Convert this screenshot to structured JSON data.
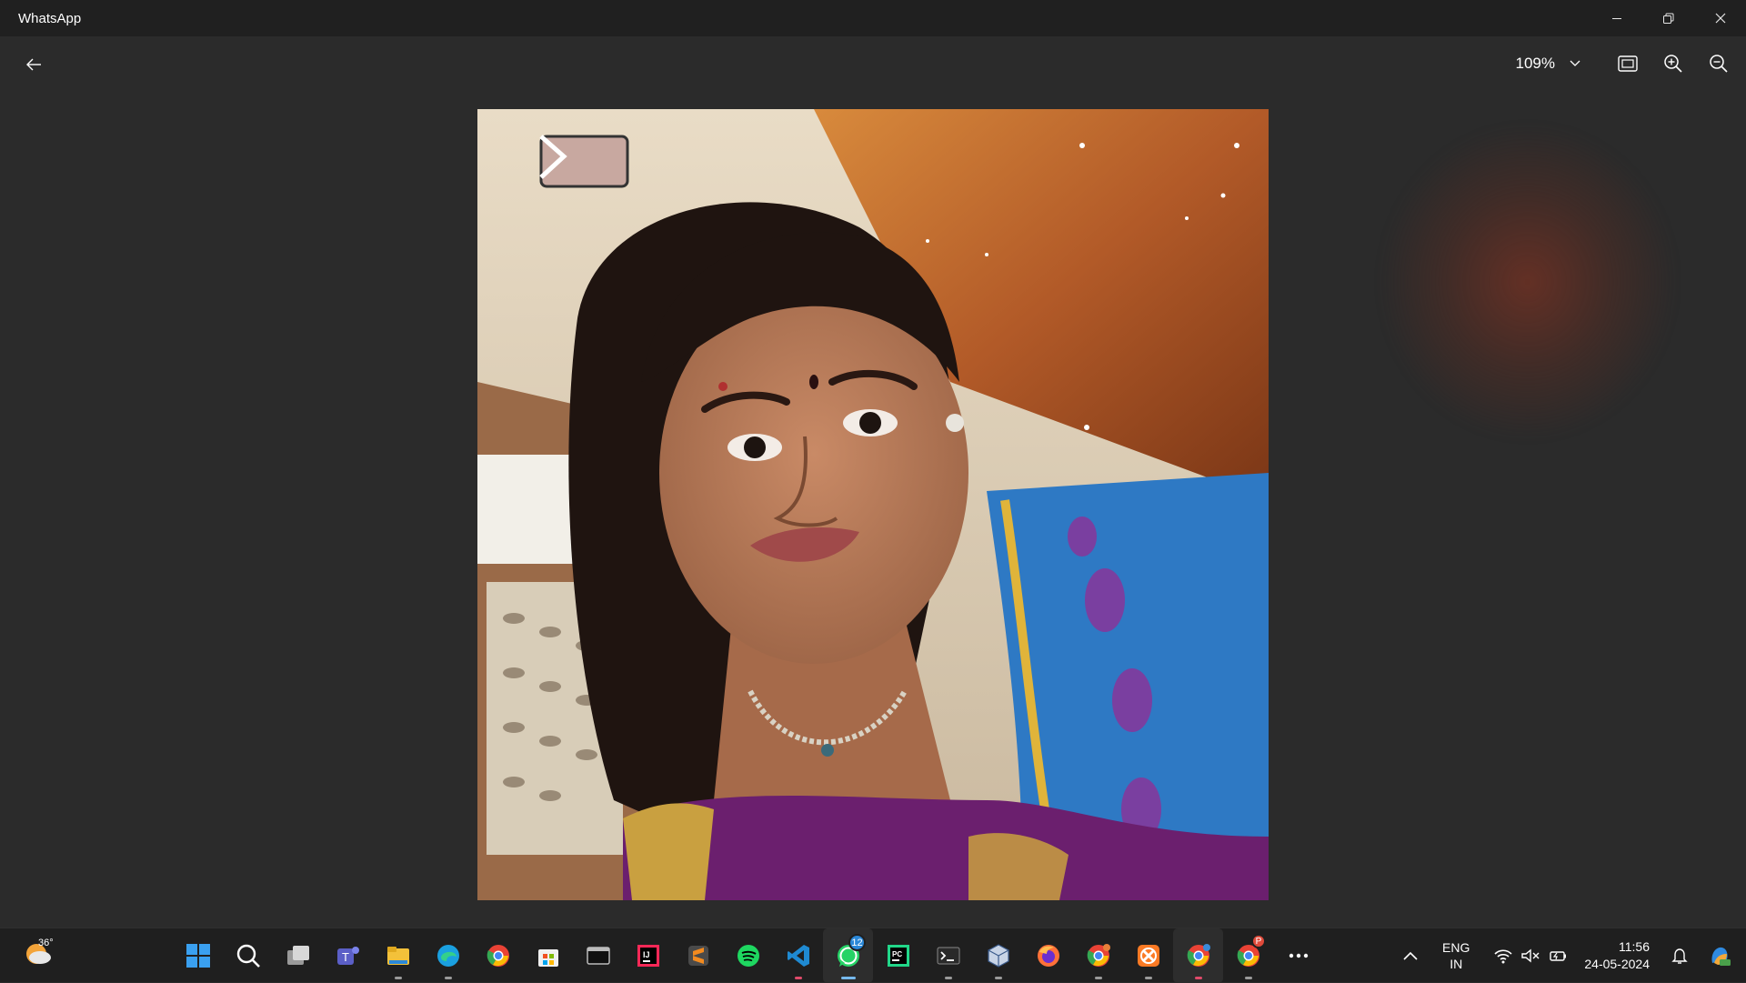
{
  "window": {
    "title": "WhatsApp"
  },
  "viewer": {
    "zoom_level": "109%"
  },
  "weather": {
    "temperature": "36°"
  },
  "taskbar": {
    "apps": [
      {
        "name": "start",
        "color": "#3aa0f0"
      },
      {
        "name": "search",
        "color": "#ffffff"
      },
      {
        "name": "task-view",
        "color": "#cfcfcf"
      },
      {
        "name": "teams",
        "color": "#5b5fc7"
      },
      {
        "name": "file-explorer",
        "color": "#f3c13a"
      },
      {
        "name": "edge",
        "color": "#1aa0e0"
      },
      {
        "name": "chrome",
        "color": "#e94235"
      },
      {
        "name": "microsoft-store",
        "color": "#f0f0f0"
      },
      {
        "name": "terminal-window",
        "color": "#3a3a3a"
      },
      {
        "name": "intellij",
        "color": "#1e2a78"
      },
      {
        "name": "sublime-text",
        "color": "#f28a1f"
      },
      {
        "name": "spotify",
        "color": "#1ed760"
      },
      {
        "name": "vscode",
        "color": "#1f8ad2"
      },
      {
        "name": "whatsapp",
        "color": "#25d366"
      },
      {
        "name": "pycharm",
        "color": "#21d789"
      },
      {
        "name": "command-prompt",
        "color": "#444444"
      },
      {
        "name": "virtualbox",
        "color": "#c8d4e6"
      },
      {
        "name": "firefox",
        "color": "#ff7139"
      },
      {
        "name": "chrome-profile",
        "color": "#e94235"
      },
      {
        "name": "xampp",
        "color": "#fb7a24"
      },
      {
        "name": "chrome-profile-2",
        "color": "#e94235"
      },
      {
        "name": "chrome-profile-3",
        "color": "#e94235"
      },
      {
        "name": "more-overflow",
        "color": "#ffffff"
      }
    ],
    "whatsapp_badge": "12",
    "chrome_badge": "P"
  },
  "tray": {
    "lang_line1": "ENG",
    "lang_line2": "IN",
    "time": "11:56",
    "date": "24-05-2024"
  }
}
